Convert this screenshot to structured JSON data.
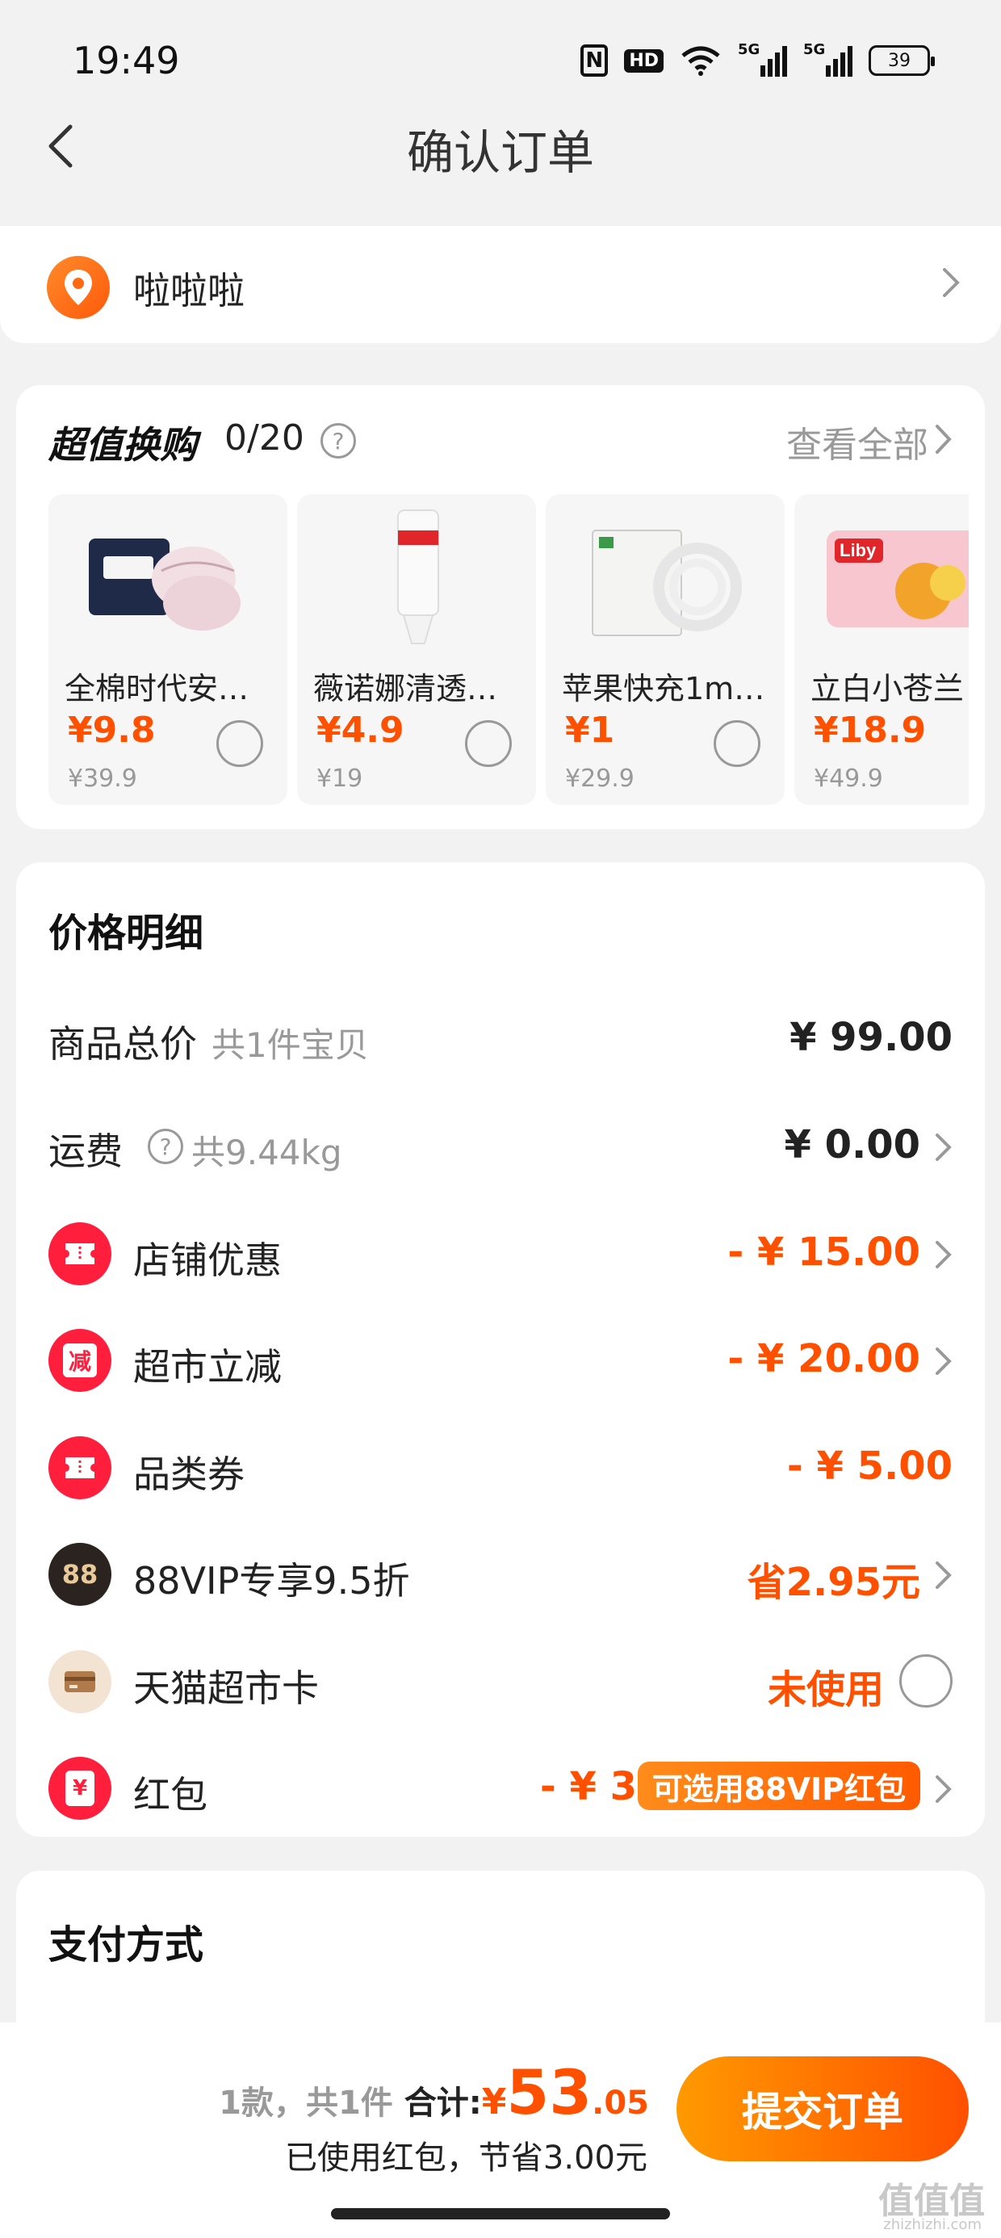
{
  "status_bar": {
    "time": "19:49",
    "battery": "39",
    "hd": "HD",
    "five_g": "5G"
  },
  "nav": {
    "title": "确认订单"
  },
  "address": {
    "name": "啦啦啦"
  },
  "swap": {
    "title": "超值换购",
    "count": "0/20",
    "view_all": "查看全部",
    "products": [
      {
        "name": "全棉时代安睡…",
        "price": "¥9.8",
        "original": "¥39.9"
      },
      {
        "name": "薇诺娜清透防…",
        "price": "¥4.9",
        "original": "¥19"
      },
      {
        "name": "苹果快充1m…",
        "price": "¥1",
        "original": "¥29.9"
      },
      {
        "name": "立白小苍兰",
        "price": "¥18.9",
        "original": "¥49.9"
      }
    ]
  },
  "price_detail": {
    "title": "价格明细",
    "goods_total": {
      "label": "商品总价",
      "sub": "共1件宝贝",
      "value": "¥ 99.00"
    },
    "shipping": {
      "label": "运费",
      "sub": "共9.44kg",
      "value": "¥ 0.00"
    },
    "shop_discount": {
      "label": "店铺优惠",
      "value": "- ¥ 15.00"
    },
    "market_reduce": {
      "label": "超市立减",
      "value": "- ¥ 20.00",
      "icon_text": "减"
    },
    "category_coupon": {
      "label": "品类券",
      "value": "- ¥ 5.00"
    },
    "vip": {
      "label": "88VIP专享9.5折",
      "value": "省2.95元",
      "icon_text": "88"
    },
    "market_card": {
      "label": "天猫超市卡",
      "value": "未使用"
    },
    "red_packet": {
      "label": "红包",
      "value": "- ¥ 3.00",
      "tag": "可选用88VIP红包",
      "icon_text": "¥"
    }
  },
  "payment": {
    "title": "支付方式"
  },
  "bottom": {
    "count_text": "1款，共1件",
    "total_label": "合计:",
    "currency": "¥",
    "total_int": "53",
    "total_dec": ".05",
    "saved_text": "已使用红包，节省3.00元",
    "submit_label": "提交订单"
  },
  "watermark": {
    "main": "值值值",
    "sub": "zhizhizhi.com"
  }
}
